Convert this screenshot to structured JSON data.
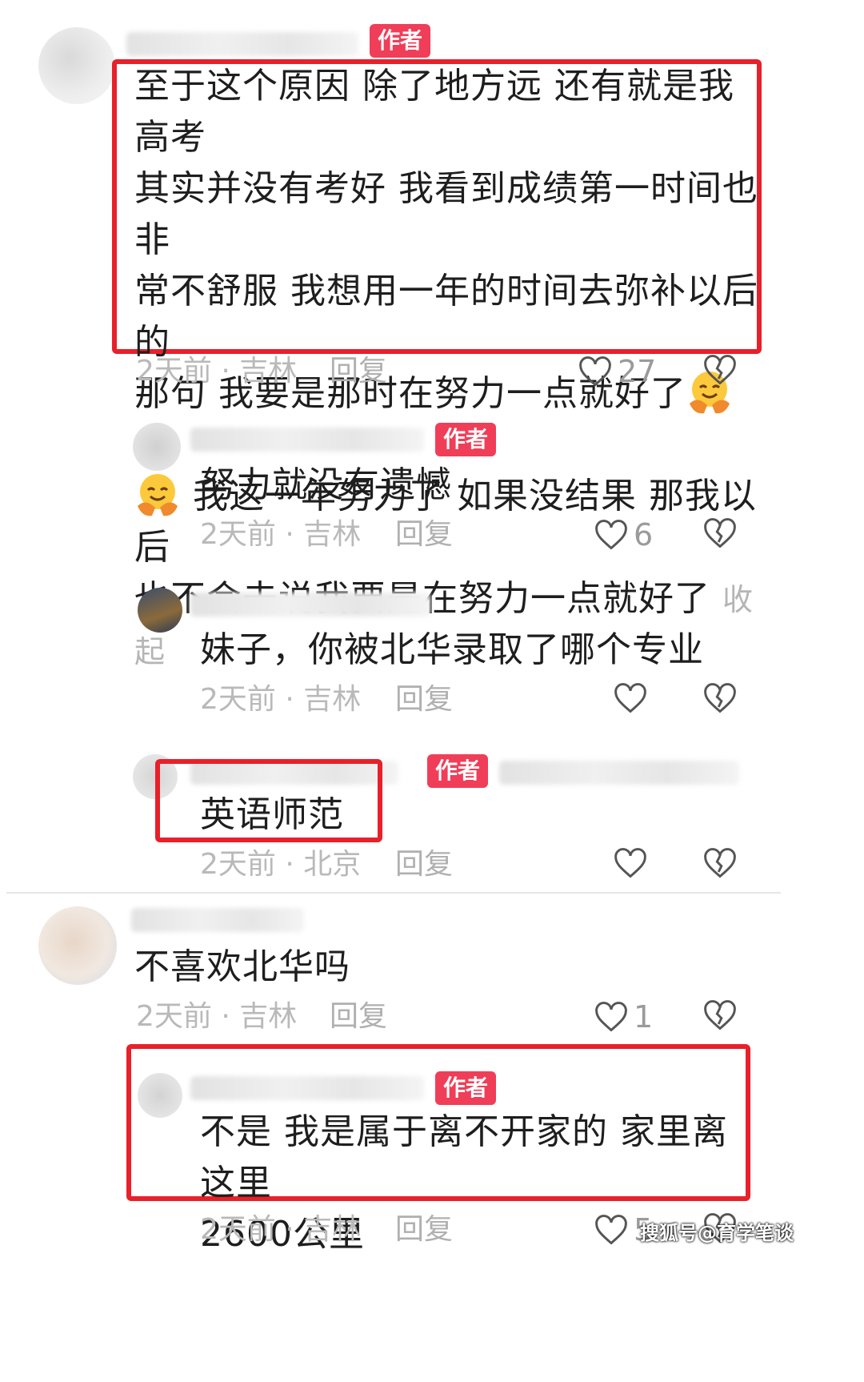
{
  "author_badge": "作者",
  "comments": [
    {
      "text_lines": [
        "至于这个原因 除了地方远 还有就是我高考",
        "其实并没有考好 我看到成绩第一时间也非",
        "常不舒服 我想用一年的时间去弥补以后的",
        "那句 我要是那时在努力一点就好了",
        "我这一年努力了 如果没结果 那我以后",
        "也不会去说我要是在努力一点就好了"
      ],
      "collapse_label": "收起",
      "time_location": "2天前 · 吉林",
      "reply_label": "回复",
      "like_count": "27"
    },
    {
      "text": "努力就没有遗憾",
      "time_location": "2天前 · 吉林",
      "reply_label": "回复",
      "like_count": "6"
    },
    {
      "text": "妹子，你被北华录取了哪个专业",
      "time_location": "2天前 · 吉林",
      "reply_label": "回复",
      "like_count": ""
    },
    {
      "text": "英语师范",
      "time_location": "2天前 · 北京",
      "reply_label": "回复",
      "like_count": ""
    },
    {
      "text": "不喜欢北华吗",
      "time_location": "2天前 · 吉林",
      "reply_label": "回复",
      "like_count": "1"
    },
    {
      "text_lines": [
        "不是 我是属于离不开家的 家里离这里",
        "2600公里"
      ],
      "time_location": "2天前 · 吉林",
      "reply_label": "回复",
      "like_count": "5"
    }
  ],
  "watermark": "搜狐号@育学笔谈",
  "colors": {
    "highlight_box": "#e8202a",
    "author_badge": "#f03e58",
    "meta_text": "#b9b9b9"
  },
  "icons": {
    "like": "heart-outline-icon",
    "dislike": "broken-heart-icon",
    "emoji": "hugging-face-emoji"
  }
}
